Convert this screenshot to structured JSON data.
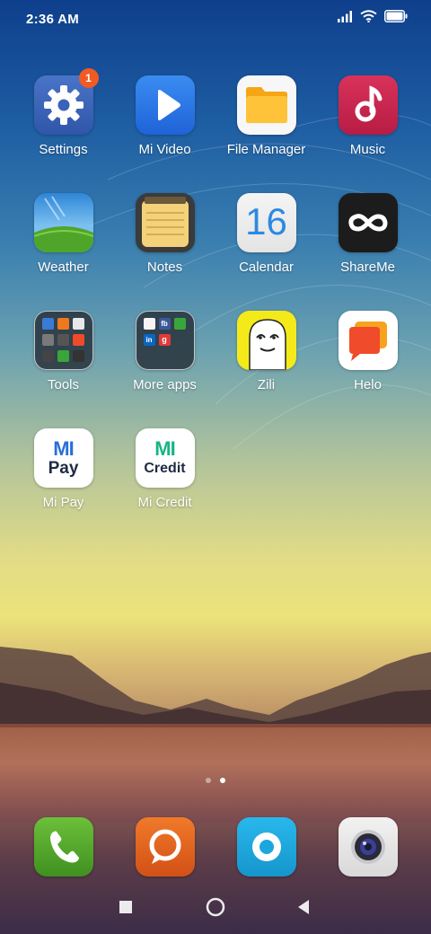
{
  "status_bar": {
    "time": "2:36 AM",
    "icons": [
      "signal-icon",
      "wifi-icon",
      "battery-icon"
    ]
  },
  "apps": [
    {
      "label": "Settings",
      "icon": "settings-gear-icon",
      "badge": "1"
    },
    {
      "label": "Mi Video",
      "icon": "play-icon"
    },
    {
      "label": "File Manager",
      "icon": "folder-icon"
    },
    {
      "label": "Music",
      "icon": "music-note-icon"
    },
    {
      "label": "Weather",
      "icon": "weather-icon"
    },
    {
      "label": "Notes",
      "icon": "notepad-icon"
    },
    {
      "label": "Calendar",
      "icon": "calendar-icon",
      "date": "16"
    },
    {
      "label": "ShareMe",
      "icon": "infinity-icon"
    },
    {
      "label": "Tools",
      "icon": "folder-grid-icon"
    },
    {
      "label": "More apps",
      "icon": "folder-grid-icon",
      "folder_items": [
        "fb",
        "in",
        "g"
      ]
    },
    {
      "label": "Zili",
      "icon": "zili-face-icon"
    },
    {
      "label": "Helo",
      "icon": "chat-bubble-icon"
    },
    {
      "label": "Mi Pay",
      "icon": "mi-pay-logo",
      "logo_text": [
        "MI",
        "Pay"
      ]
    },
    {
      "label": "Mi Credit",
      "icon": "mi-credit-logo",
      "logo_text": [
        "MI",
        "Credit"
      ]
    }
  ],
  "dock": [
    {
      "name": "phone",
      "icon": "phone-icon"
    },
    {
      "name": "messaging",
      "icon": "message-icon"
    },
    {
      "name": "browser",
      "icon": "browser-icon"
    },
    {
      "name": "camera",
      "icon": "camera-icon"
    }
  ],
  "page_indicator": {
    "pages": 2,
    "active": 2
  },
  "navbar": {
    "buttons": [
      "recents-icon",
      "home-icon",
      "back-icon"
    ]
  },
  "colors": {
    "badge": "#f15a23",
    "settings": "#3a63b8",
    "mi_video": "#2f7be8",
    "file_manager": "#ffb425",
    "music": "#c8204a",
    "shareme": "#1d1d1d",
    "zili": "#f4ea1a",
    "helo": "#f04b2a",
    "phone": "#5aa42a",
    "messaging": "#e06020",
    "browser": "#1aa7de",
    "camera": "#e6e6e6"
  }
}
